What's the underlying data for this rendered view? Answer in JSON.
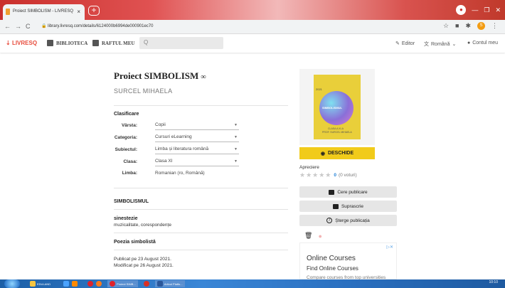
{
  "browser": {
    "tab_title": "Proiect SIMBOLISM - LIVRESQ",
    "tab_close": "×",
    "new_tab": "+",
    "nav_buttons": "←→C",
    "url": "library.livresq.com/details/6124000b6994de000901ec70"
  },
  "appnav": {
    "logo": "LIVRESQ",
    "biblioteca": "BIBLIOTECA",
    "raftul": "RAFTUL MEU",
    "search_placeholder": "Q",
    "editor": "Editor",
    "language": "Română",
    "account": "Contul meu"
  },
  "book": {
    "title": "Proiect SIMBOLISM",
    "author": "SURCEL MIHAELA",
    "clasificare_label": "Clasificare",
    "fields": [
      {
        "label": "Vârsta:",
        "value": "Copii"
      },
      {
        "label": "Categoria:",
        "value": "Cursuri eLearning"
      },
      {
        "label": "Subiectul:",
        "value": "Limba și literatura română"
      },
      {
        "label": "Clasa:",
        "value": "Clasa XI"
      },
      {
        "label": "Limba:",
        "value": "Romanian (ro, Română)"
      }
    ],
    "section1": "SIMBOLISMUL",
    "keywords_title": "sinestezie",
    "keywords_text": "muzicalitate, corespondențe",
    "section2": "Poezia simbolistă",
    "published": "Publicat pe 23 August 2021.",
    "modified": "Modificat pe 26 August 2021."
  },
  "cover": {
    "year": "2021",
    "title": "SIMBOLISMUL",
    "line1": "CLASA A XI-A",
    "line2": "PROF. SURCEL MIHAELA"
  },
  "actions": {
    "open": "DESCHIDE",
    "rating_label": "Apreciere",
    "rating_stars": "★★★★★",
    "rating_count": "0",
    "rating_votes": "(0 voturi)",
    "request": "Cere publicare",
    "overwrite": "Suprascrie",
    "delete": "Șterge publicația"
  },
  "ad": {
    "close": "▷✕",
    "title": "Online Courses",
    "subtitle": "Find Online Courses",
    "text": "Compare courses from top universities"
  },
  "taskbar": {
    "item1": "EDULAND",
    "item2": "Proiect SIMB...",
    "item3": "Articol Platfo...",
    "clock": "10:10"
  }
}
